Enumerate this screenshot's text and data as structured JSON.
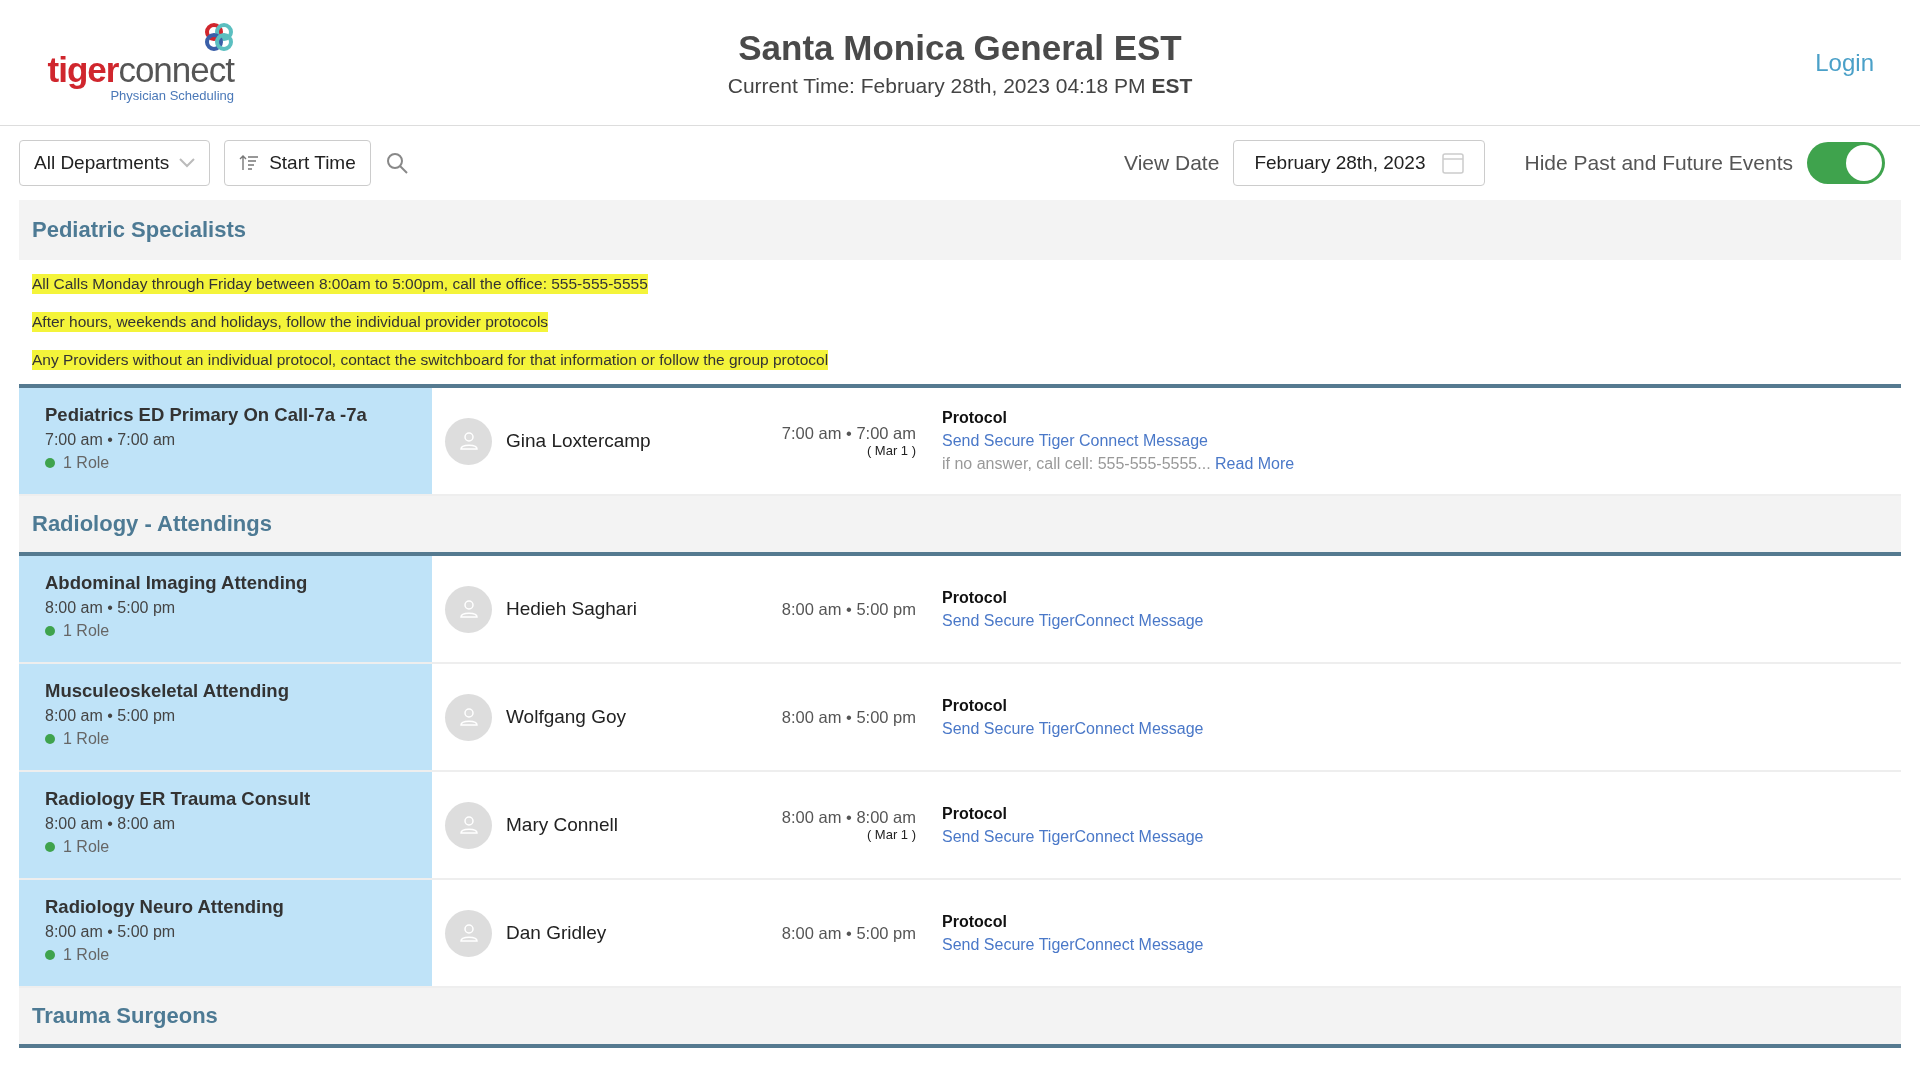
{
  "header": {
    "logo": {
      "part_a": "tiger",
      "part_b": "connect",
      "subtitle": "Physician Scheduling"
    },
    "title": "Santa Monica General EST",
    "current_time": "Current Time: February 28th, 2023 04:18 PM **EST**",
    "login": "Login"
  },
  "toolbar": {
    "department": "All Departments",
    "sort": "Start Time",
    "view_date_label": "View Date",
    "view_date": "February 28th, 2023",
    "hide_events_label": "Hide Past and Future Events",
    "hide_events_on": true
  },
  "sections": [
    {
      "title": "Pediatric Specialists",
      "notes": [
        "All Calls Monday through Friday between 8:00am to 5:00pm, call the office: 555-555-5555",
        "After hours, weekends and holidays, follow the individual provider protocols",
        "Any Providers without an individual protocol, contact the switchboard for that information or follow the group protocol"
      ],
      "shifts": [
        {
          "role": "Pediatrics ED Primary On Call-7a -7a",
          "hours": "7:00 am • 7:00 am",
          "roles": "1 Role",
          "person": "Gina Loxtercamp",
          "time": "7:00 am • 7:00 am",
          "next_day": "( Mar 1 )",
          "protocol_label": "Protocol",
          "protocol_link": "Send Secure Tiger Connect Message",
          "protocol_note": "if no answer, call cell: 555-555-5555...",
          "read_more": "Read More"
        }
      ]
    },
    {
      "title": "Radiology - Attendings",
      "shifts": [
        {
          "role": "Abdominal Imaging Attending",
          "hours": "8:00 am • 5:00 pm",
          "roles": "1 Role",
          "person": "Hedieh Saghari",
          "time": "8:00 am • 5:00 pm",
          "protocol_label": "Protocol",
          "protocol_link": "Send Secure TigerConnect Message"
        },
        {
          "role": "Musculeoskeletal Attending",
          "hours": "8:00 am • 5:00 pm",
          "roles": "1 Role",
          "person": "Wolfgang Goy",
          "time": "8:00 am • 5:00 pm",
          "protocol_label": "Protocol",
          "protocol_link": "Send Secure TigerConnect Message"
        },
        {
          "role": "Radiology ER Trauma Consult",
          "hours": "8:00 am • 8:00 am",
          "roles": "1 Role",
          "person": "Mary Connell",
          "time": "8:00 am • 8:00 am",
          "next_day": "( Mar 1 )",
          "protocol_label": "Protocol",
          "protocol_link": "Send Secure TigerConnect Message"
        },
        {
          "role": "Radiology Neuro Attending",
          "hours": "8:00 am • 5:00 pm",
          "roles": "1 Role",
          "person": "Dan Gridley",
          "time": "8:00 am • 5:00 pm",
          "protocol_label": "Protocol",
          "protocol_link": "Send Secure TigerConnect Message"
        }
      ]
    },
    {
      "title": "Trauma Surgeons"
    }
  ]
}
